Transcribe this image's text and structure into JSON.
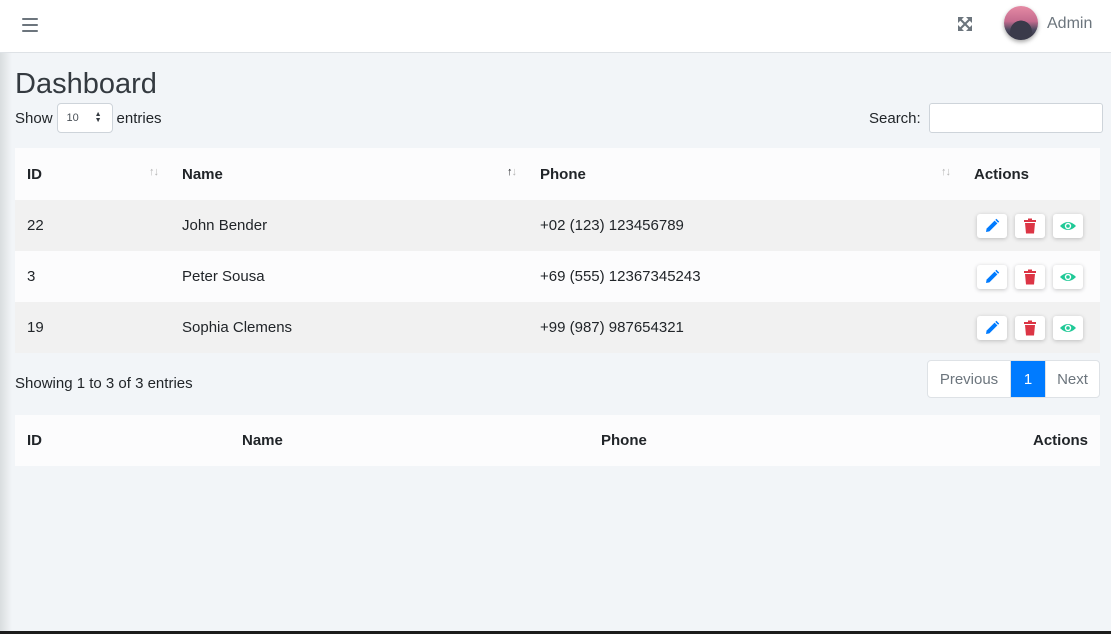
{
  "navbar": {
    "menu_icon": "hamburger-icon",
    "fullscreen_icon": "expand-arrows-icon",
    "user_name": "Admin"
  },
  "page": {
    "title": "Dashboard"
  },
  "length_menu": {
    "show_label": "Show",
    "selected": "10",
    "entries_label": "entries"
  },
  "search": {
    "label": "Search:",
    "value": ""
  },
  "table": {
    "columns": [
      "ID",
      "Name",
      "Phone",
      "Actions"
    ],
    "sorted_column": "Name",
    "sort_direction": "ascending",
    "rows": [
      {
        "id": "22",
        "name": "John Bender",
        "phone": "+02 (123) 123456789"
      },
      {
        "id": "3",
        "name": "Peter Sousa",
        "phone": "+69 (555) 12367345243"
      },
      {
        "id": "19",
        "name": "Sophia Clemens",
        "phone": "+99 (987) 987654321"
      }
    ],
    "action_icons": [
      "pencil-icon",
      "trash-icon",
      "eye-icon"
    ]
  },
  "colors": {
    "edit": "#007bff",
    "delete": "#dc3545",
    "view": "#20c997",
    "active_page": "#007bff"
  },
  "footer": {
    "info": "Showing 1 to 3 of 3 entries",
    "pagination": {
      "previous": "Previous",
      "current": "1",
      "next": "Next"
    }
  },
  "table2": {
    "columns": [
      "ID",
      "Name",
      "Phone",
      "Actions"
    ]
  }
}
